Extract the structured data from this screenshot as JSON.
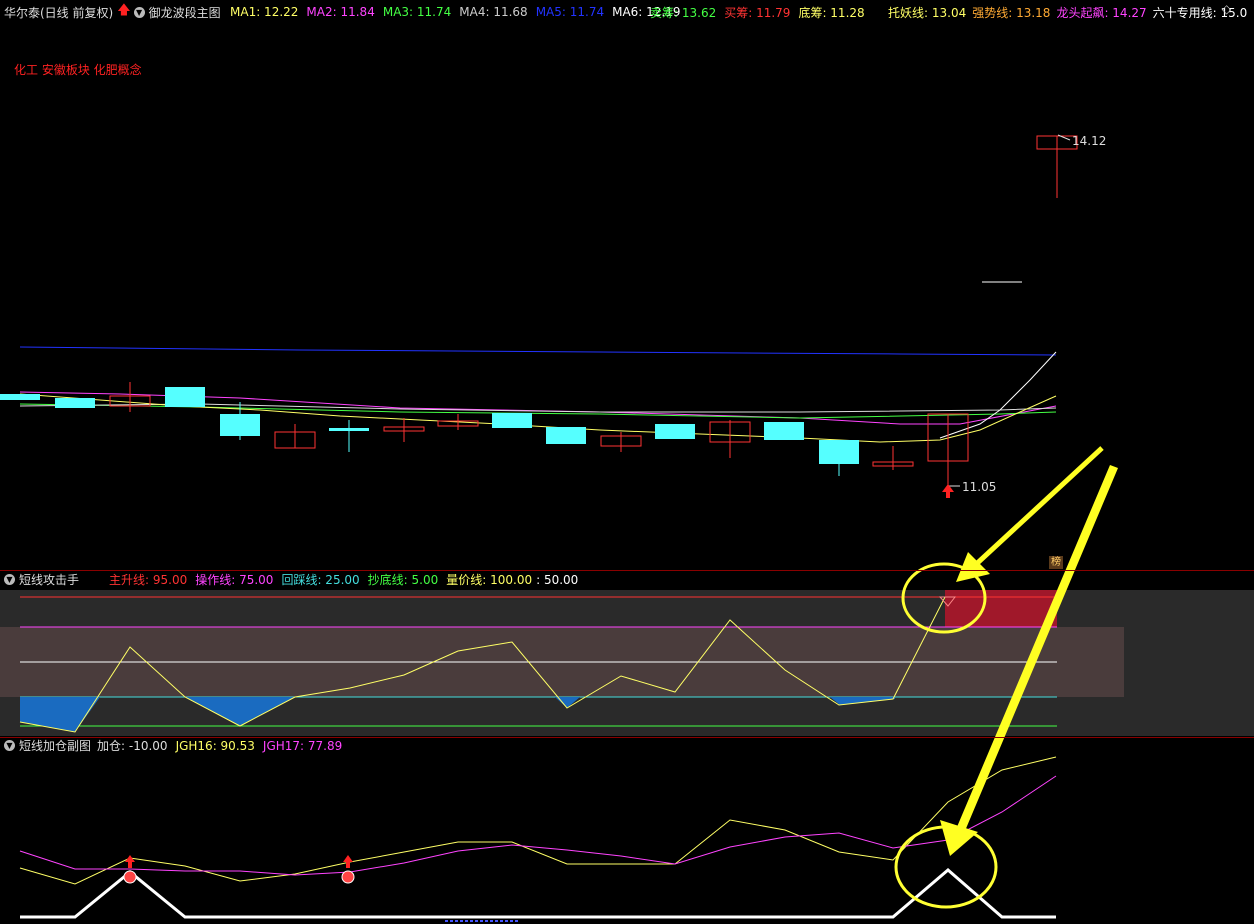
{
  "header": {
    "stock_title": "华尔泰(日线 前复权)",
    "main_chart_name": "御龙波段主图",
    "ma": [
      {
        "label": "MA1: 12.22",
        "color": "#ffff66"
      },
      {
        "label": "MA2: 11.84",
        "color": "#ff44ff"
      },
      {
        "label": "MA3: 11.74",
        "color": "#44ff44"
      },
      {
        "label": "MA4: 11.68",
        "color": "#cccccc"
      },
      {
        "label": "MA5: 11.74",
        "color": "#2233ff"
      },
      {
        "label": "MA6: 12.19",
        "color": "#ffffff"
      }
    ],
    "chips": [
      {
        "label": "卖筹: 13.62",
        "color": "#44ff44"
      },
      {
        "label": "买筹: 11.79",
        "color": "#ff3333"
      },
      {
        "label": "底筹: 11.28",
        "color": "#ffff66"
      }
    ],
    "lines": [
      {
        "label": "托妖线: 13.04",
        "color": "#ffff66"
      },
      {
        "label": "强势线: 13.18",
        "color": "#ffaa33"
      },
      {
        "label": "龙头起飙: 14.27",
        "color": "#ff44ff"
      },
      {
        "label": "六十专用线: 15.0",
        "color": "#ffffff"
      }
    ]
  },
  "main": {
    "sector_tags": "化工 安徽板块 化肥概念",
    "high_label": "14.12",
    "low_label": "11.05",
    "ranking_badge": "榜"
  },
  "panel1": {
    "name": "短线攻击手",
    "legend": [
      {
        "label": "主升线: 95.00",
        "color": "#ff3333"
      },
      {
        "label": "操作线: 75.00",
        "color": "#ff44ff"
      },
      {
        "label": "回踩线: 25.00",
        "color": "#44dddd"
      },
      {
        "label": "抄底线: 5.00",
        "color": "#44ff44"
      },
      {
        "label": "量价线: 100.00",
        "color": "#ffff66"
      },
      {
        "label": ": 50.00",
        "color": "#ffffff"
      }
    ]
  },
  "panel2": {
    "name": "短线加仓副图",
    "legend": [
      {
        "label": "加仓: -10.00",
        "color": "#dddddd"
      },
      {
        "label": "JGH16: 90.53",
        "color": "#ffff66"
      },
      {
        "label": "JGH17: 77.89",
        "color": "#ff44ff"
      }
    ]
  }
}
